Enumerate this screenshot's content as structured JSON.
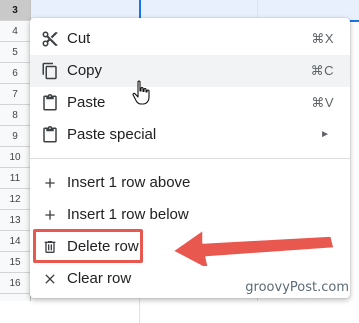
{
  "sheet": {
    "row_numbers": [
      "3",
      "4",
      "5",
      "6",
      "7",
      "8",
      "9",
      "10",
      "11",
      "12",
      "13",
      "14",
      "15",
      "16"
    ],
    "selected_row": "3"
  },
  "menu": {
    "items": [
      {
        "label": "Cut",
        "shortcut": "⌘X",
        "icon": "scissors-icon"
      },
      {
        "label": "Copy",
        "shortcut": "⌘C",
        "icon": "copy-icon"
      },
      {
        "label": "Paste",
        "shortcut": "⌘V",
        "icon": "clipboard-icon"
      },
      {
        "label": "Paste special",
        "submenu_arrow": "►",
        "icon": "clipboard-icon"
      },
      {
        "label": "Insert 1 row above",
        "icon": "plus-icon"
      },
      {
        "label": "Insert 1 row below",
        "icon": "plus-icon"
      },
      {
        "label": "Delete row",
        "icon": "trash-icon"
      },
      {
        "label": "Clear row",
        "icon": "x-icon"
      }
    ]
  },
  "annotation": {
    "highlight_color": "#e8584f"
  },
  "accent_color": "#1a73e8",
  "watermark": "groovyPost.com"
}
